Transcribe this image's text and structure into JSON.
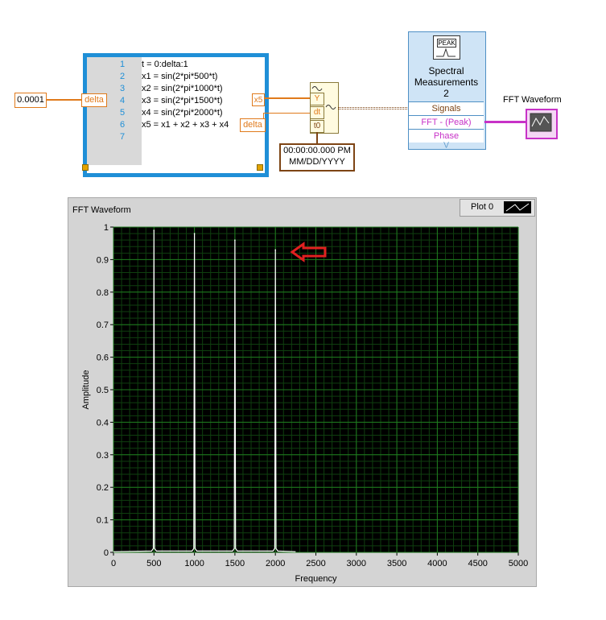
{
  "diagram": {
    "constant_value": "0.0001",
    "delta_label": "delta",
    "y_terminal": "Y",
    "dt_terminal": "dt",
    "t0_terminal": "t0",
    "x5_terminal": "x5",
    "delta_terminal2": "delta",
    "timestamp_line1": "00:00:00.000 PM",
    "timestamp_line2": "MM/DD/YYYY",
    "code_lines": [
      {
        "num": "1",
        "text": "t = 0:delta:1"
      },
      {
        "num": "2",
        "text": "x1 = sin(2*pi*500*t)"
      },
      {
        "num": "3",
        "text": "x2 = sin(2*pi*1000*t)"
      },
      {
        "num": "4",
        "text": "x3 = sin(2*pi*1500*t)"
      },
      {
        "num": "5",
        "text": "x4 = sin(2*pi*2000*t)"
      },
      {
        "num": "6",
        "text": "x5 = x1 + x2 + x3 + x4"
      },
      {
        "num": "7",
        "text": ""
      }
    ],
    "express_vi": {
      "icon_label": "PEAK",
      "title_line1": "Spectral",
      "title_line2": "Measurements",
      "title_line3": "2",
      "rows": [
        "Signals",
        "FFT - (Peak)",
        "Phase"
      ]
    },
    "indicator_label": "FFT Waveform"
  },
  "graph": {
    "title": "FFT Waveform",
    "legend_label": "Plot 0"
  },
  "chart_data": {
    "type": "line",
    "title": "FFT Waveform",
    "xlabel": "Frequency",
    "ylabel": "Amplitude",
    "xlim": [
      0,
      5000
    ],
    "ylim": [
      0,
      1
    ],
    "x_ticks": [
      "0",
      "500",
      "1000",
      "1500",
      "2000",
      "2500",
      "3000",
      "3500",
      "4000",
      "4500",
      "5000"
    ],
    "y_ticks": [
      "0",
      "0.1",
      "0.2",
      "0.3",
      "0.4",
      "0.5",
      "0.6",
      "0.7",
      "0.8",
      "0.9",
      "1"
    ],
    "grid": true,
    "legend": "top-right",
    "series": [
      {
        "name": "Plot 0",
        "peaks": [
          {
            "x": 500,
            "y": 0.99
          },
          {
            "x": 1000,
            "y": 0.98
          },
          {
            "x": 1500,
            "y": 0.96
          },
          {
            "x": 2000,
            "y": 0.93
          }
        ],
        "x_end": 2250
      }
    ],
    "colors": {
      "plot": "#ffffff",
      "background": "#000000",
      "grid_major": "#1f7a1f",
      "grid_minor": "#0f3f0f"
    }
  }
}
